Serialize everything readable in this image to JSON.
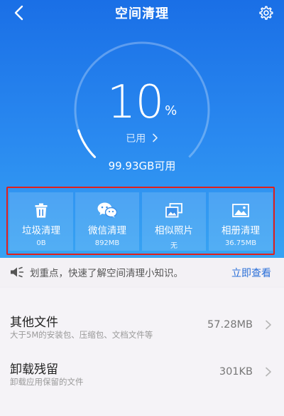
{
  "header": {
    "title": "空间清理",
    "back_icon": "chevron-left-icon",
    "settings_icon": "gear-icon"
  },
  "storage": {
    "used_percent": 10,
    "percent_number": "10",
    "percent_unit": "%",
    "used_label": "已用",
    "available_text": "99.93GB可用"
  },
  "tiles": [
    {
      "label": "垃圾清理",
      "value": "0B",
      "icon": "trash-icon"
    },
    {
      "label": "微信清理",
      "value": "892MB",
      "icon": "wechat-icon"
    },
    {
      "label": "相似照片",
      "value": "无",
      "icon": "photo-stack-icon"
    },
    {
      "label": "相册清理",
      "value": "36.75MB",
      "icon": "image-icon"
    }
  ],
  "tip": {
    "text": "划重点，快速了解空间清理小知识。",
    "link": "立即查看",
    "icon": "speaker-icon"
  },
  "items": [
    {
      "title": "其他文件",
      "subtitle": "大于5M的安装包、压缩包、文档文件等",
      "size": "57.28MB"
    },
    {
      "title": "卸载残留",
      "subtitle": "卸载应用保留的文件",
      "size": "301KB"
    }
  ],
  "colors": {
    "accent": "#1a6fe6",
    "highlight_border": "#e0201c",
    "link": "#2a6fd8"
  }
}
